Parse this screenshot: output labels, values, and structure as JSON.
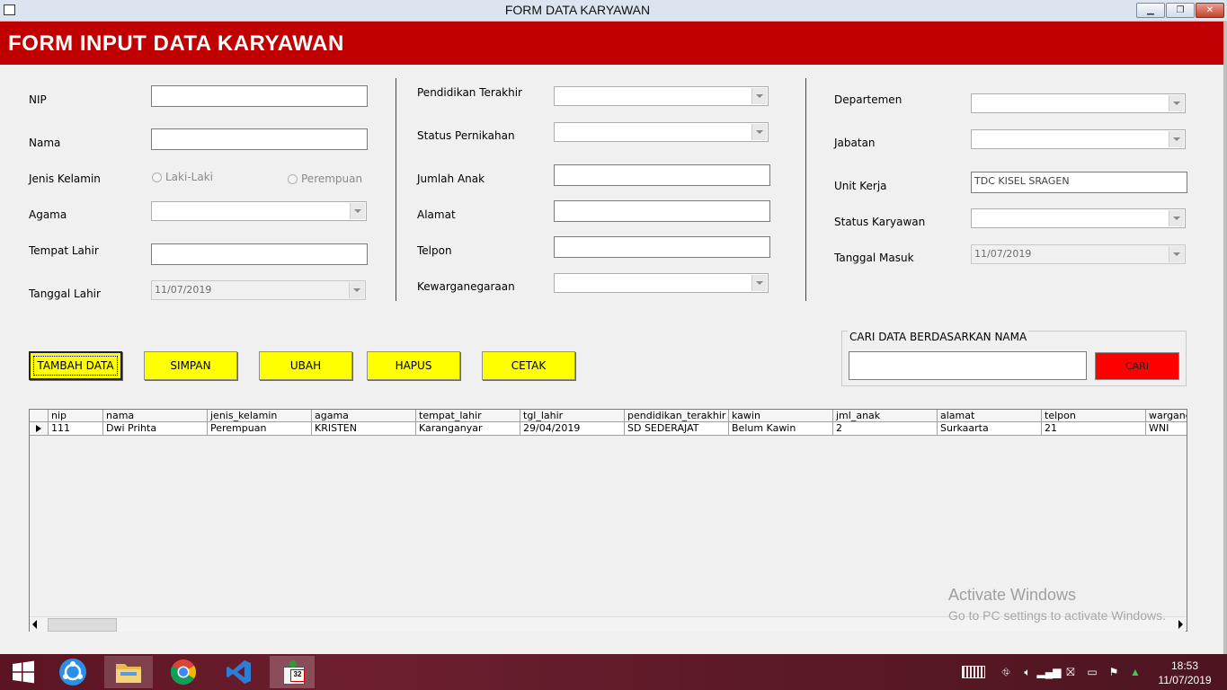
{
  "window": {
    "title": "FORM DATA KARYAWAN"
  },
  "header": {
    "title": "FORM INPUT DATA KARYAWAN"
  },
  "col1": {
    "nip_label": "NIP",
    "nama_label": "Nama",
    "jk_label": "Jenis Kelamin",
    "radio_laki": "Laki-Laki",
    "radio_perempuan": "Perempuan",
    "agama_label": "Agama",
    "tempat_label": "Tempat Lahir",
    "tanggal_label": "Tanggal Lahir",
    "tanggal_value": "11/07/2019"
  },
  "col2": {
    "pendidikan_label": "Pendidikan Terakhir",
    "status_nikah_label": "Status Pernikahan",
    "jumlah_anak_label": "Jumlah Anak",
    "alamat_label": "Alamat",
    "telpon_label": "Telpon",
    "kewarganegaraan_label": "Kewarganegaraan"
  },
  "col3": {
    "departemen_label": "Departemen",
    "jabatan_label": "Jabatan",
    "unit_label": "Unit Kerja",
    "unit_value": "TDC KISEL SRAGEN",
    "status_karyawan_label": "Status Karyawan",
    "tanggal_masuk_label": "Tanggal Masuk",
    "tanggal_masuk_value": "11/07/2019"
  },
  "buttons": {
    "tambah": "TAMBAH DATA",
    "simpan": "SIMPAN",
    "ubah": "UBAH",
    "hapus": "HAPUS",
    "cetak": "CETAK"
  },
  "search": {
    "group_label": "CARI DATA BERDASARKAN NAMA",
    "button": "CARI"
  },
  "grid": {
    "headers": [
      "nip",
      "nama",
      "jenis_kelamin",
      "agama",
      "tempat_lahir",
      "tgl_lahir",
      "pendidikan_terakhir",
      "kawin",
      "jml_anak",
      "alamat",
      "telpon",
      "wargane"
    ],
    "row": [
      "111",
      "Dwi Prihta",
      "Perempuan",
      "KRISTEN",
      "Karanganyar",
      "29/04/2019",
      "SD SEDERAJAT",
      "Belum Kawin",
      "2",
      "Surkaarta",
      "21",
      "WNI"
    ]
  },
  "watermark": {
    "line1": "Activate Windows",
    "line2": "Go to PC settings to activate Windows."
  },
  "taskbar": {
    "time": "18:53",
    "date": "11/07/2019",
    "badge": "32"
  },
  "colors": {
    "banner": "#c00000",
    "button_yellow": "#ffff00",
    "search_button": "#ff0000"
  }
}
